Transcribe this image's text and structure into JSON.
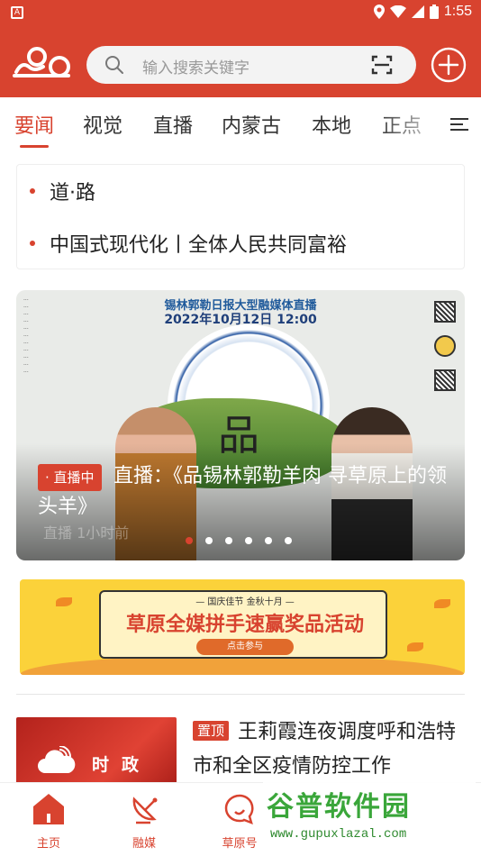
{
  "status_bar": {
    "time": "1:55",
    "app_indicator": "A"
  },
  "header": {
    "search_placeholder": "输入搜索关键字",
    "icons": [
      "app-logo",
      "search-icon",
      "scan-icon",
      "add-circle-icon"
    ]
  },
  "tabs": [
    {
      "label": "要闻",
      "active": true
    },
    {
      "label": "视觉",
      "active": false
    },
    {
      "label": "直播",
      "active": false
    },
    {
      "label": "内蒙古",
      "active": false
    },
    {
      "label": "本地",
      "active": false
    },
    {
      "label": "正点",
      "active": false
    }
  ],
  "headlines": [
    {
      "text": "道·路"
    },
    {
      "text": "中国式现代化丨全体人民共同富裕"
    }
  ],
  "banner": {
    "poster_title": "锡林郭勒日报大型融媒体直播",
    "poster_date": "2022年10月12日 12:00",
    "poster_calligraphy": "品",
    "live_badge": "· 直播中",
    "caption": "直播：《品锡林郭勒羊肉 寻草原上的领头羊》",
    "sub_caption": "直播  1小时前",
    "slide_count": 6,
    "active_slide": 1
  },
  "promo": {
    "subline": "— 国庆佳节  金秋十月 —",
    "title": "草原全媒拼手速赢奖品活动",
    "cta": "点击参与"
  },
  "featured_news": {
    "thumb_label": "时政",
    "pin_badge": "置顶",
    "title": "王莉霞连夜调度呼和浩特市和全区疫情防控工作"
  },
  "bottom_nav": [
    {
      "label": "主页"
    },
    {
      "label": "融媒"
    },
    {
      "label": "草原号"
    }
  ],
  "watermark": {
    "logo": "谷普软件园",
    "url": "www.gupuxlazal.com"
  },
  "colors": {
    "brand_red": "#d8432f",
    "promo_yellow": "#fbd23a"
  }
}
